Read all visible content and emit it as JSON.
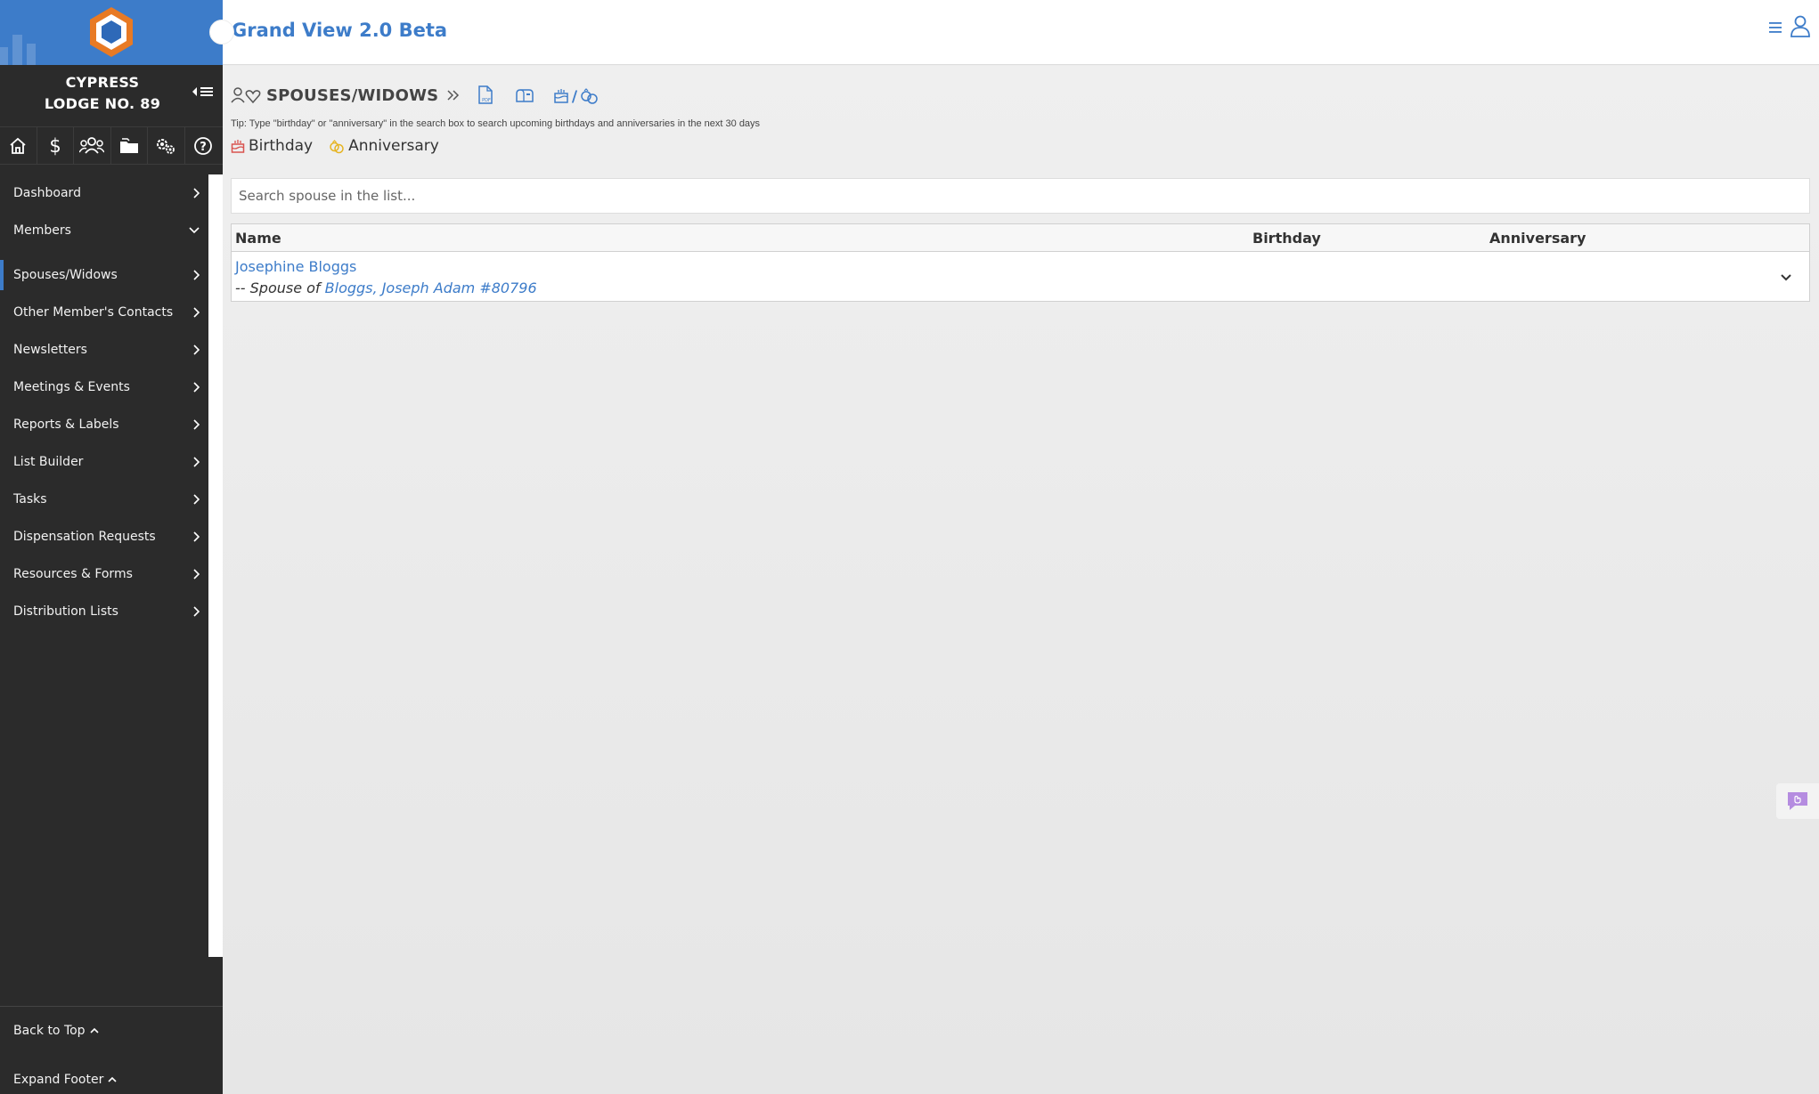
{
  "sidebar": {
    "lodge_name_line1": "CYPRESS",
    "lodge_name_line2": "LODGE NO. 89",
    "icon_row": [
      "home-icon",
      "dollar-icon",
      "members-group-icon",
      "folders-icon",
      "settings-gears-icon",
      "help-icon"
    ],
    "nav_items": [
      {
        "label": "Dashboard",
        "chevron": "right"
      },
      {
        "label": "Members",
        "chevron": "down"
      },
      {
        "label": "Spouses/Widows",
        "chevron": "right",
        "active": true
      },
      {
        "label": "Other Member's Contacts",
        "chevron": "right"
      },
      {
        "label": "Newsletters",
        "chevron": "right"
      },
      {
        "label": "Meetings & Events",
        "chevron": "right"
      },
      {
        "label": "Reports & Labels",
        "chevron": "right"
      },
      {
        "label": "List Builder",
        "chevron": "right"
      },
      {
        "label": "Tasks",
        "chevron": "right"
      },
      {
        "label": "Dispensation Requests",
        "chevron": "right"
      },
      {
        "label": "Resources & Forms",
        "chevron": "right"
      },
      {
        "label": "Distribution Lists",
        "chevron": "right"
      }
    ],
    "footer": {
      "back_to_top": "Back to Top",
      "expand_footer": "Expand Footer"
    }
  },
  "header": {
    "app_title": "Grand View 2.0 Beta"
  },
  "page": {
    "title": "SPOUSES/WIDOWS",
    "tip": "Tip: Type \"birthday\" or \"anniversary\" in the search box to search upcoming birthdays and anniversaries in the next 30 days",
    "legend": {
      "birthday": "Birthday",
      "anniversary": "Anniversary"
    },
    "search": {
      "placeholder": "Search spouse in the list..."
    },
    "table": {
      "columns": [
        "Name",
        "Birthday",
        "Anniversary"
      ],
      "rows": [
        {
          "name": "Josephine Bloggs",
          "spouse_prefix": "-- Spouse of ",
          "spouse_of": "Bloggs, Joseph Adam #80796",
          "birthday": "",
          "anniversary": ""
        }
      ]
    }
  },
  "colors": {
    "brand_blue": "#3d7cc9",
    "sidebar_bg": "#2b2b2b",
    "logo_orange": "#e87a24",
    "birthday_red": "#d9534f",
    "anniversary_gold": "#e6b422",
    "feedback_purple": "#b58ce0"
  }
}
